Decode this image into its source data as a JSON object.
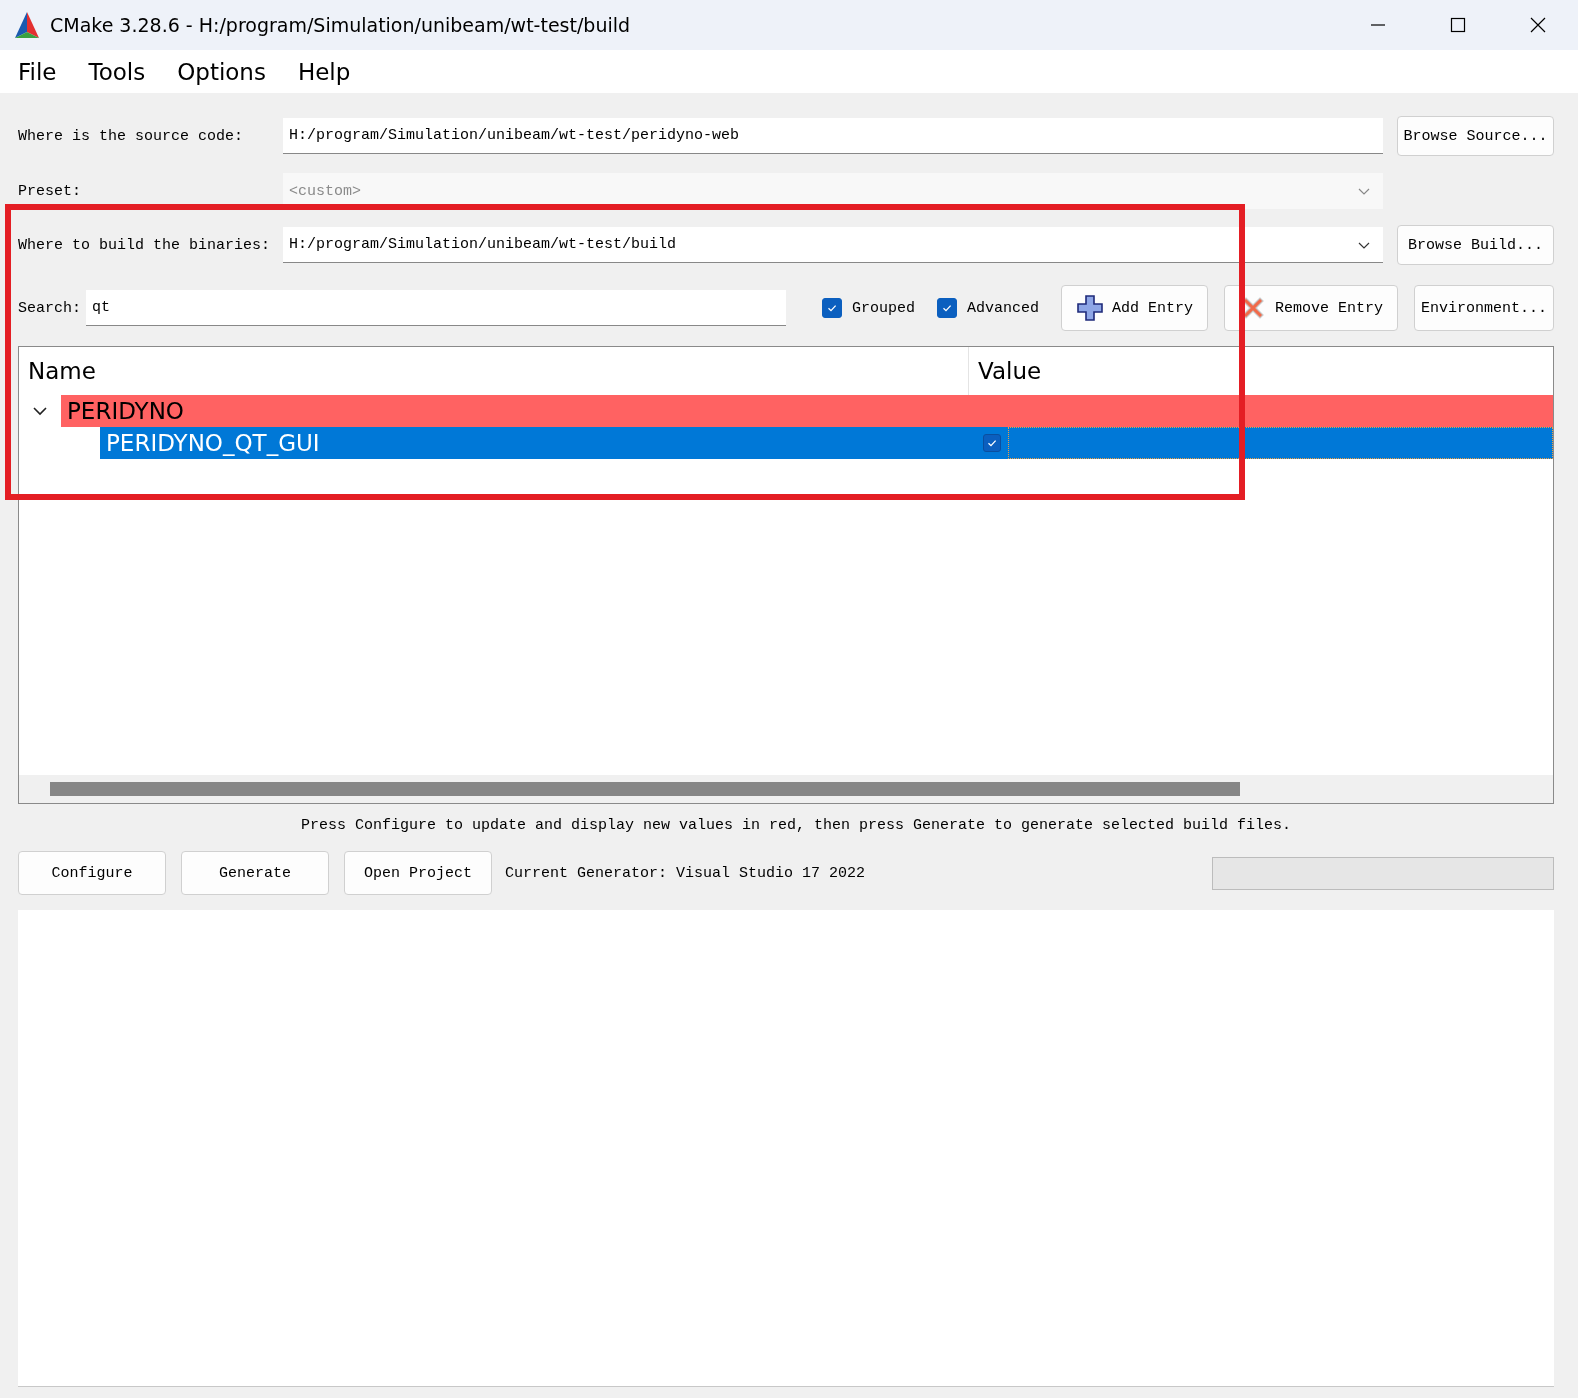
{
  "window": {
    "title": "CMake 3.28.6 - H:/program/Simulation/unibeam/wt-test/build"
  },
  "menu": [
    "File",
    "Tools",
    "Options",
    "Help"
  ],
  "source": {
    "label": "Where is the source code:",
    "value": "H:/program/Simulation/unibeam/wt-test/peridyno-web",
    "button": "Browse Source..."
  },
  "preset": {
    "label": "Preset:",
    "value": "<custom>",
    "disabled": true
  },
  "build": {
    "label": "Where to build the binaries:",
    "value": "H:/program/Simulation/unibeam/wt-test/build",
    "button": "Browse Build..."
  },
  "search": {
    "label": "Search:",
    "value": "qt"
  },
  "options": [
    {
      "label": "Grouped",
      "checked": true
    },
    {
      "label": "Advanced",
      "checked": true
    }
  ],
  "entry_buttons": [
    {
      "label": "Add Entry",
      "kind": "add"
    },
    {
      "label": "Remove Entry",
      "kind": "remove"
    },
    {
      "label": "Environment...",
      "kind": "plain"
    }
  ],
  "tree": {
    "columns": [
      "Name",
      "Value"
    ],
    "rows": [
      {
        "name": "PERIDYNO",
        "expanded": true,
        "changed": true,
        "children": [
          {
            "name": "PERIDYNO_QT_GUI",
            "kind": "bool",
            "checked": true,
            "selected": true
          }
        ]
      }
    ]
  },
  "status_text": "Press Configure to update and display new values in red, then press Generate to generate selected build files.",
  "actions": [
    "Configure",
    "Generate",
    "Open Project"
  ],
  "generator": "Current Generator: Visual Studio 17 2022",
  "progress": {
    "level": 0
  }
}
